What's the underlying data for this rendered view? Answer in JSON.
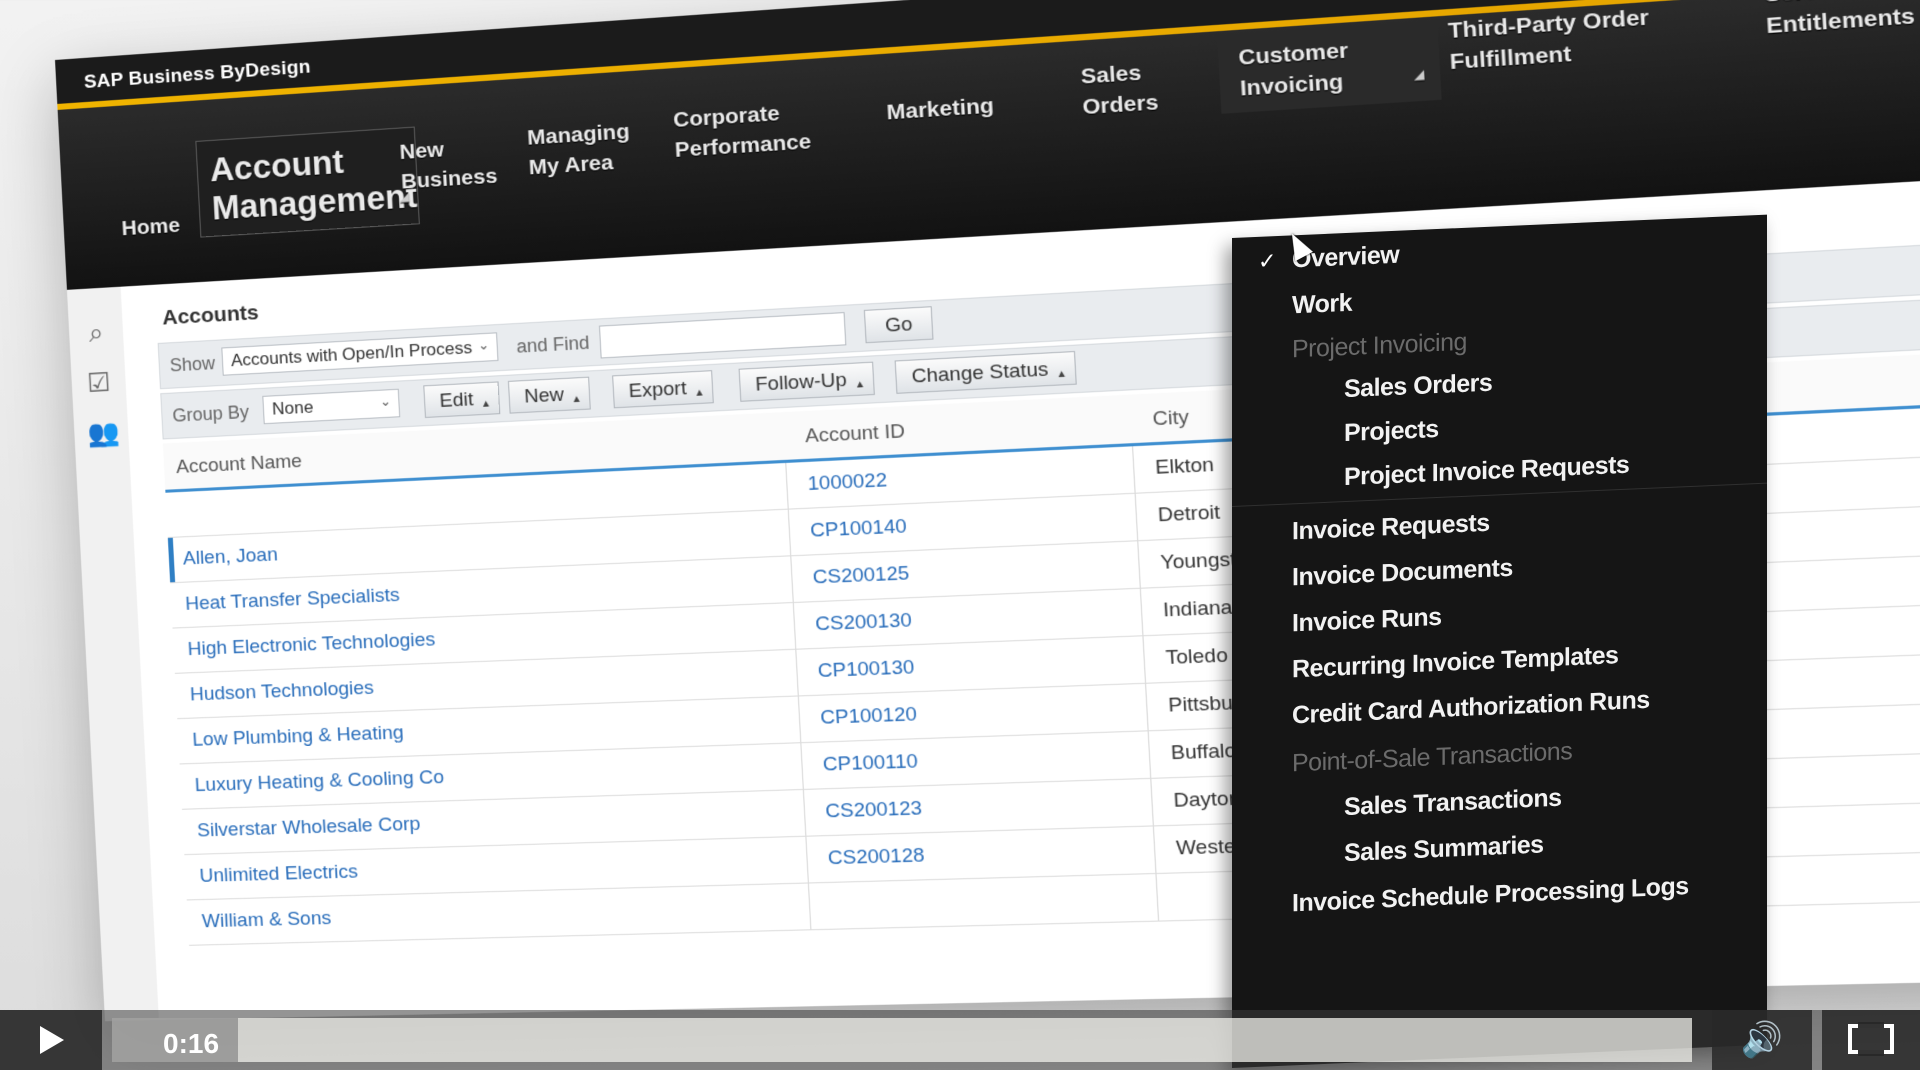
{
  "app": {
    "brand": "SAP Business ByDesign",
    "accent_color": "#f0b400"
  },
  "nav": {
    "home": "Home",
    "account_management": "Account Management",
    "new_business": "New Business",
    "managing_my_area": "Managing My Area",
    "corporate_performance": "Corporate Performance",
    "marketing": "Marketing",
    "sales_orders": "Sales Orders",
    "customer_invoicing": "Customer Invoicing",
    "third_party": "Third-Party Order Fulfillment",
    "service_entitlements": "Service Entitlements"
  },
  "rail": {
    "icons": [
      "search-icon",
      "checklist-icon",
      "people-icon"
    ]
  },
  "accounts": {
    "title": "Accounts",
    "show_label": "Show",
    "show_value": "Accounts with Open/In Process",
    "and_find_label": "and Find",
    "find_value": "",
    "go_label": "Go",
    "group_by_label": "Group By",
    "group_by_value": "None",
    "buttons": {
      "edit": "Edit",
      "new": "New",
      "export": "Export",
      "follow_up": "Follow-Up",
      "change_status": "Change Status"
    },
    "columns": {
      "name": "Account Name",
      "id": "Account ID",
      "city": "City"
    },
    "rows": [
      {
        "name": "",
        "id": "1000022",
        "city": "Elkton"
      },
      {
        "name": "Allen, Joan",
        "id": "CP100140",
        "city": "Detroit"
      },
      {
        "name": "Heat Transfer Specialists",
        "id": "CS200125",
        "city": "Youngstown"
      },
      {
        "name": "High Electronic Technologies",
        "id": "CS200130",
        "city": "Indianapolis"
      },
      {
        "name": "Hudson Technologies",
        "id": "CP100130",
        "city": "Toledo"
      },
      {
        "name": "Low Plumbing & Heating",
        "id": "CP100120",
        "city": "Pittsburgh"
      },
      {
        "name": "Luxury Heating & Cooling Co",
        "id": "CP100110",
        "city": "Buffalo"
      },
      {
        "name": "Silverstar Wholesale Corp",
        "id": "CS200123",
        "city": "Dayton"
      },
      {
        "name": "Unlimited Electrics",
        "id": "CS200128",
        "city": "Westerville"
      },
      {
        "name": "William & Sons",
        "id": "",
        "city": ""
      }
    ]
  },
  "menu": {
    "overview": "Overview",
    "work": "Work",
    "project_invoicing": "Project Invoicing",
    "sales_orders": "Sales Orders",
    "projects": "Projects",
    "project_invoice_requests": "Project Invoice Requests",
    "invoice_requests": "Invoice Requests",
    "invoice_documents": "Invoice Documents",
    "invoice_runs": "Invoice Runs",
    "recurring_invoice_templates": "Recurring Invoice Templates",
    "credit_card_authorization_runs": "Credit Card Authorization Runs",
    "point_of_sale": "Point-of-Sale Transactions",
    "sales_transactions": "Sales Transactions",
    "sales_summaries": "Sales Summaries",
    "invoice_schedule_logs": "Invoice Schedule Processing Logs",
    "check_glyph": "✓"
  },
  "video": {
    "time": "0:16",
    "progress": 0.008
  }
}
